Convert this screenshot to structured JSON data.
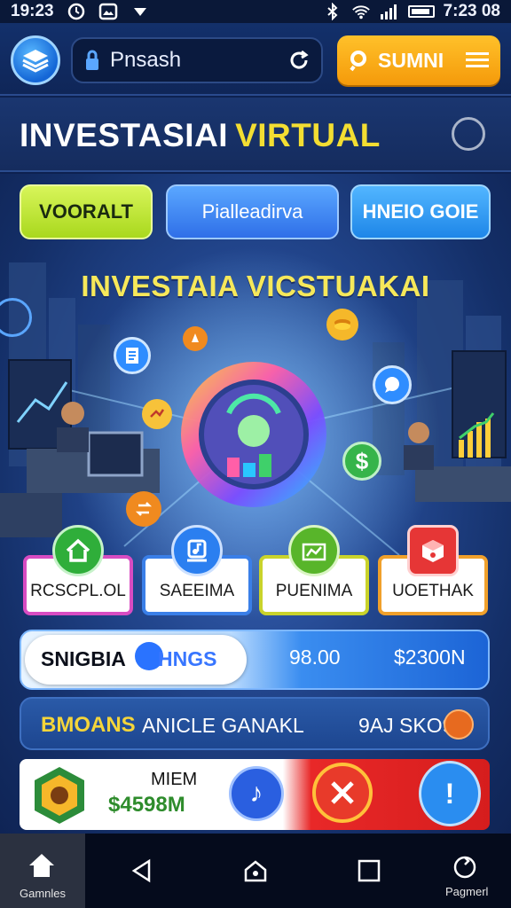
{
  "status_bar": {
    "time_left": "19:23",
    "time_right": "7:23 08"
  },
  "app_bar": {
    "search_value": "Pnsash",
    "submit_label": "SUMNI"
  },
  "title": {
    "part1": "INVESTASIAI",
    "part2": "VIRTUAL"
  },
  "tabs": [
    {
      "label": "VOORALT"
    },
    {
      "label": "Pialleadirva"
    },
    {
      "label": "HNEIO GOIE"
    }
  ],
  "hero_title": "INVESTAIA VICSTUAKAI",
  "categories": [
    {
      "label": "RCSCPL.OL",
      "icon": "home-icon",
      "color": "#2fae3a",
      "border": "#d84cc2"
    },
    {
      "label": "SAEEIMA",
      "icon": "music-icon",
      "color": "#2b7ff0",
      "border": "#3a7fe8"
    },
    {
      "label": "PUENIMA",
      "icon": "chart-icon",
      "color": "#58b52a",
      "border": "#c9d32b"
    },
    {
      "label": "UOETHAK",
      "icon": "cube-icon",
      "color": "#e63636",
      "border": "#f0a02b"
    }
  ],
  "balance": {
    "label": "SNIGBIA",
    "label2": "HNGS",
    "value1": "98.00",
    "value2": "$2300N"
  },
  "ticker": {
    "highlight": "BMOANS",
    "text": "ANICLE GANAKL",
    "right": "9AJ SKO9"
  },
  "promo": {
    "heading": "MIEM",
    "amount": "$4598M"
  },
  "nav": {
    "home_label": "Gamnles",
    "right_label": "Pagmerl"
  },
  "colors": {
    "accent": "#f59a0a",
    "title_yellow": "#f3de32",
    "background": "#0d2150"
  }
}
